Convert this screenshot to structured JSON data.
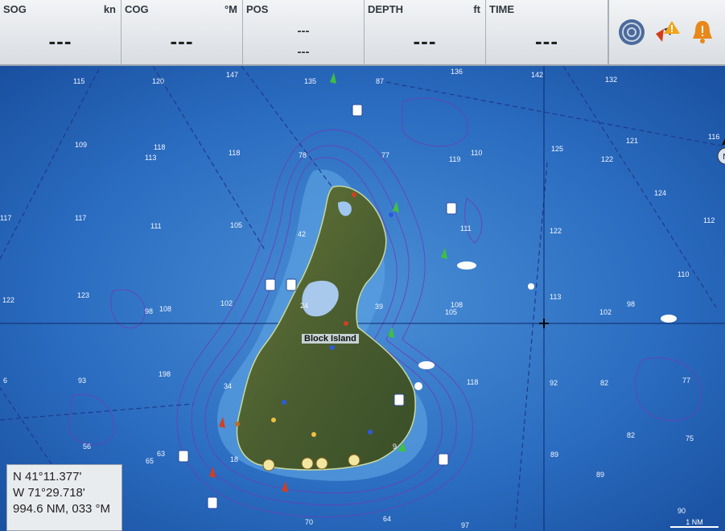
{
  "data_bar": {
    "sog": {
      "label": "SOG",
      "unit": "kn",
      "value": "---"
    },
    "cog": {
      "label": "COG",
      "unit": "°M",
      "value": "---"
    },
    "pos": {
      "label": "POS",
      "line1": "---",
      "line2": "---"
    },
    "depth": {
      "label": "DEPTH",
      "unit": "ft",
      "value": "---"
    },
    "time": {
      "label": "TIME",
      "value": "---"
    }
  },
  "icons": [
    "radar-icon",
    "wind-warning-icon",
    "alarm-icon"
  ],
  "map": {
    "place_label": "Block Island",
    "depths": [
      "115",
      "120",
      "147",
      "135",
      "87",
      "136",
      "142",
      "132",
      "109",
      "118",
      "113",
      "118",
      "78",
      "77",
      "119",
      "110",
      "125",
      "122",
      "121",
      "116",
      "117",
      "117",
      "111",
      "105",
      "42",
      "111",
      "122",
      "124",
      "112",
      "102",
      "108",
      "113",
      "110",
      "122",
      "123",
      "98",
      "108",
      "24",
      "39",
      "105",
      "98",
      "102",
      "93",
      "198",
      "34",
      "118",
      "92",
      "82",
      "77",
      "6",
      "56",
      "65",
      "63",
      "18",
      "89",
      "89",
      "82",
      "75",
      "70",
      "64",
      "97",
      "90",
      "9"
    ],
    "scale_label": "1 NM"
  },
  "cursor_panel": {
    "lat": "N  41°11.377'",
    "lon": "W  71°29.718'",
    "range_bearing": "994.6 NM, 033 °M"
  }
}
